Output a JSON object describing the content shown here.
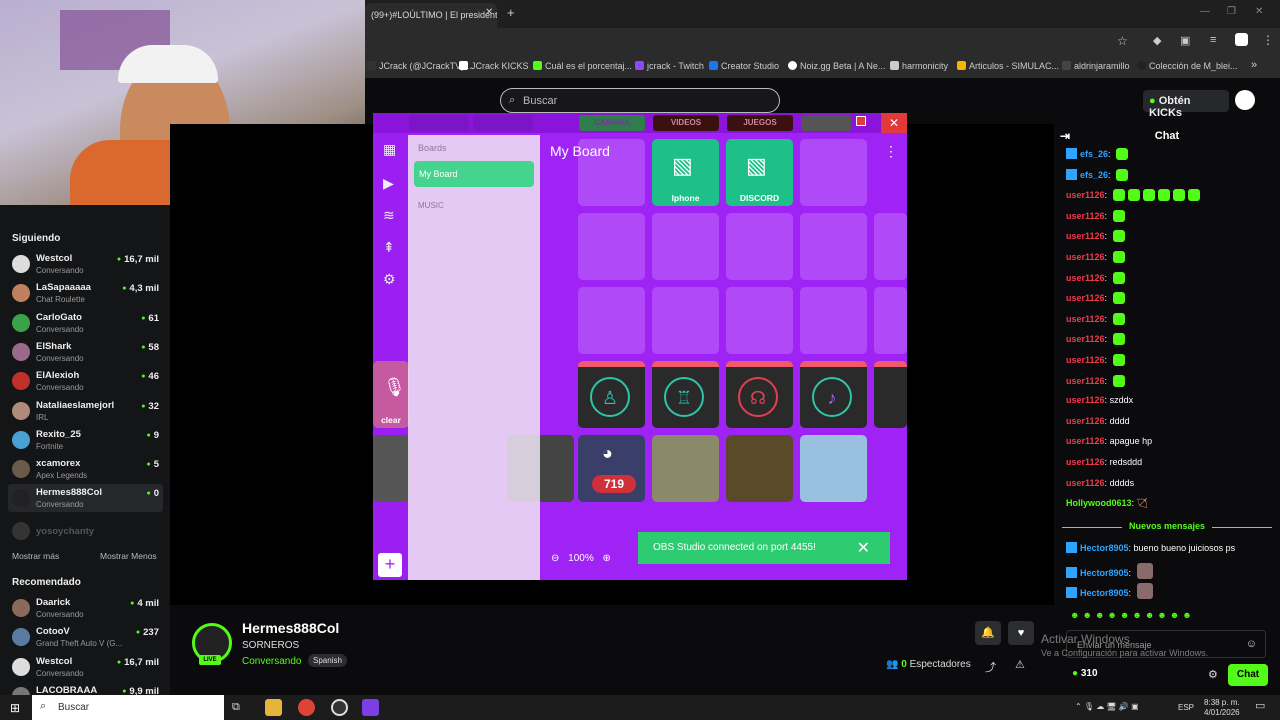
{
  "browser": {
    "tab_title": "(99+)#LOÚLTIMO | El presidente",
    "bookmarks": [
      "JCrack (@JCrackTV)...",
      "JCrack KICKS",
      "Cuál es el porcentaj...",
      "jcrack - Twitch",
      "Creator Studio",
      "Noiz.gg Beta | A Ne...",
      "harmonicity",
      "Articulos - SIMULAC...",
      "aldrinjaramillo",
      "Colección de M_blei..."
    ]
  },
  "header": {
    "search_placeholder": "Buscar",
    "kicks_button": "Obtén KICKs"
  },
  "sidebar": {
    "following_title": "Siguiendo",
    "following": [
      {
        "name": "Westcol",
        "sub": "Conversando",
        "count": "16,7 mil",
        "color": "#dddddd"
      },
      {
        "name": "LaSapaaaaa",
        "sub": "Chat Roulette",
        "count": "4,3 mil",
        "color": "#c08060"
      },
      {
        "name": "CarloGato",
        "sub": "Conversando",
        "count": "61",
        "color": "#3aa34a"
      },
      {
        "name": "ElShark",
        "sub": "Conversando",
        "count": "58",
        "color": "#9a6a8a"
      },
      {
        "name": "ElAlexioh",
        "sub": "Conversando",
        "count": "46",
        "color": "#c0302a"
      },
      {
        "name": "Nataliaeslamejorl",
        "sub": "IRL",
        "count": "32",
        "color": "#b08a7a"
      },
      {
        "name": "Rexito_25",
        "sub": "Fortnite",
        "count": "9",
        "color": "#4aa0d0"
      },
      {
        "name": "xcamorex",
        "sub": "Apex Legends",
        "count": "5",
        "color": "#6a5a4a"
      },
      {
        "name": "Hermes888Col",
        "sub": "Conversando",
        "count": "0",
        "color": "#222222"
      }
    ],
    "offline": "yosoychanty",
    "show_more": "Mostrar más",
    "show_less": "Mostrar Menos",
    "recommended_title": "Recomendado",
    "recommended": [
      {
        "name": "Daarick",
        "sub": "Conversando",
        "count": "4 mil",
        "color": "#8a6a5a"
      },
      {
        "name": "CotooV",
        "sub": "Grand Theft Auto V (G...",
        "count": "237",
        "color": "#5a7aa0"
      },
      {
        "name": "Westcol",
        "sub": "Conversando",
        "count": "16,7 mil",
        "color": "#dddddd"
      },
      {
        "name": "LACOBRAAA",
        "sub": "",
        "count": "9,9 mil",
        "color": "#777777"
      }
    ]
  },
  "deck": {
    "top_cells": [
      "CAMARA",
      "VIDEOS",
      "JUEGOS"
    ],
    "boards_title": "Boards",
    "board_active": "My Board",
    "board_music": "MUSIC",
    "board_title": "My Board",
    "cell_iphone": "Iphone",
    "cell_discord": "DISCORD",
    "clear_label": "clear",
    "discord_badge": "719",
    "zoom": "100%",
    "toast": "OBS Studio connected on port 4455!"
  },
  "channel": {
    "name": "Hermes888Col",
    "title": "SORNEROS",
    "category": "Conversando",
    "language": "Spanish",
    "live": "LIVE",
    "viewers": "0",
    "viewers_label": "Espectadores"
  },
  "chat": {
    "title": "Chat",
    "messages": [
      {
        "user": "efs_26",
        "cls": "u-blue",
        "text": "",
        "emotes": 1
      },
      {
        "user": "efs_26",
        "cls": "u-blue",
        "text": "",
        "emotes": 1
      },
      {
        "user": "user1126",
        "cls": "u-red",
        "text": "",
        "emotes": 6
      },
      {
        "user": "user1126",
        "cls": "u-red",
        "text": "",
        "emotes": 1
      },
      {
        "user": "user1126",
        "cls": "u-red",
        "text": "",
        "emotes": 1
      },
      {
        "user": "user1126",
        "cls": "u-red",
        "text": "",
        "emotes": 1
      },
      {
        "user": "user1126",
        "cls": "u-red",
        "text": "",
        "emotes": 1
      },
      {
        "user": "user1126",
        "cls": "u-red",
        "text": "",
        "emotes": 1
      },
      {
        "user": "user1126",
        "cls": "u-red",
        "text": "",
        "emotes": 1
      },
      {
        "user": "user1126",
        "cls": "u-red",
        "text": "",
        "emotes": 1
      },
      {
        "user": "user1126",
        "cls": "u-red",
        "text": "",
        "emotes": 1
      },
      {
        "user": "user1126",
        "cls": "u-red",
        "text": "",
        "emotes": 1
      },
      {
        "user": "user1126",
        "cls": "u-red",
        "text": "szddx",
        "emotes": 0
      },
      {
        "user": "user1126",
        "cls": "u-red",
        "text": "dddd",
        "emotes": 0
      },
      {
        "user": "user1126",
        "cls": "u-red",
        "text": "apague hp",
        "emotes": 0
      },
      {
        "user": "user1126",
        "cls": "u-red",
        "text": "redsddd",
        "emotes": 0
      },
      {
        "user": "user1126",
        "cls": "u-red",
        "text": "dddds",
        "emotes": 0
      },
      {
        "user": "Hollywood0613",
        "cls": "u-green",
        "text": "🏹",
        "emotes": 0
      }
    ],
    "new_messages": "Nuevos mensajes",
    "new": [
      {
        "user": "Hector8905",
        "text": "bueno bueno juiciosos ps"
      },
      {
        "user": "Hector8905",
        "text": ""
      },
      {
        "user": "Hector8905",
        "text": ""
      }
    ],
    "input_placeholder": "Enviar un mensaje",
    "send_button": "Chat",
    "kicks_count": "310"
  },
  "windows": {
    "watermark_title": "Activar Windows",
    "watermark_sub": "Ve a Configuración para activar Windows.",
    "search": "Buscar",
    "lang": "ESP",
    "time": "8:38 p. m.",
    "date": "4/01/2026"
  }
}
